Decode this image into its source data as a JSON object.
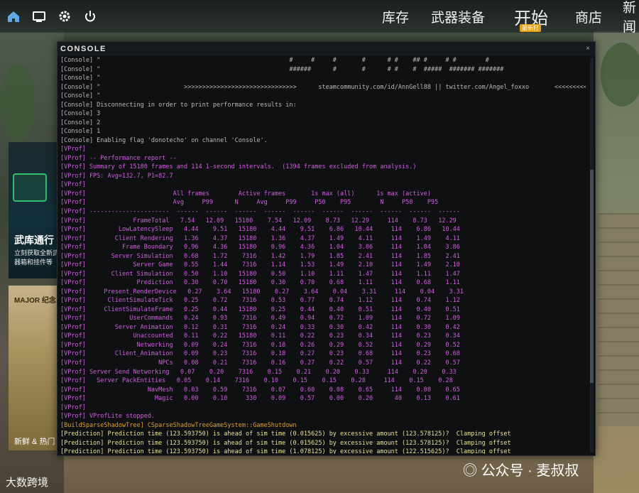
{
  "topbar": {
    "icons": [
      "home-icon",
      "tv-icon",
      "gear-icon",
      "power-icon"
    ],
    "nav": [
      "库存",
      "武器装备",
      "开始",
      "商店",
      "新闻"
    ],
    "badge": "最新打"
  },
  "promo": {
    "title": "武库通行",
    "subtitle": "立刻获取全新武器箱和挂件等",
    "major": "MAJOR 纪念",
    "new_label": "新鲜 & 热门"
  },
  "console": {
    "title": "CONSOLE",
    "close": "×",
    "lines": [
      {
        "text": "[Console] \"                                                    #     #     #       #      # #    ## #     # #        #",
        "kind": "console"
      },
      {
        "text": "[Console] \"                                                    ######      #       #      # #    #  #####  ####### #######",
        "kind": "console"
      },
      {
        "text": "[Console] \"",
        "kind": "console"
      },
      {
        "text": "[Console] \"                       >>>>>>>>>>>>>>>>>>>>>>>>>>>>>>>      steamcommunity.com/id/AnnGell88 || twitter.com/Angel_foxxo       <<<<<<<<<<<<<<<<<<<<<<<<<<<<",
        "kind": "console"
      },
      {
        "text": "[Console] \"",
        "kind": "console"
      },
      {
        "text": "[Console] Disconnecting in order to print performance results in:",
        "kind": "console"
      },
      {
        "text": "[Console] 3",
        "kind": "console"
      },
      {
        "text": "[Console] 2",
        "kind": "console"
      },
      {
        "text": "[Console] 1",
        "kind": "console"
      },
      {
        "text": "[Console] Enabling flag 'donotecho' on channel 'Console'.",
        "kind": "console"
      },
      {
        "text": "[VProf]",
        "kind": "vprof"
      },
      {
        "text": "[VProf] -- Performance report --",
        "kind": "vprof"
      },
      {
        "text": "[VProf] Summary of 15180 frames and 114 1-second intervals.  (1394 frames excluded from analysis.)",
        "kind": "vprof"
      },
      {
        "text": "[VProf] FPS: Avg=132.7, P1=82.7",
        "kind": "vprof"
      },
      {
        "text": "[VProf]",
        "kind": "vprof"
      },
      {
        "text": "[VProf]                        All frames        Active frames       1s max (all)      1s max (active)",
        "kind": "vprof"
      },
      {
        "text": "[VProf]                        Avg     P99      N     Avg     P99     P50    P95        N     P50    P95",
        "kind": "vprof"
      },
      {
        "text": "[VProf] ----------------------  ------  ------  ------  ------  ------  ------  ------  ------  ------  ------",
        "kind": "vprof"
      },
      {
        "text": "[VProf]             FrameTotal   7.54   12.09   15180    7.54   12.09    8.73   12.29     114    8.73   12.29",
        "kind": "vprof"
      },
      {
        "text": "[VProf]         LowLatencySleep   4.44    9.51   15180    4.44    9.51    6.86   10.44     114    6.86   10.44",
        "kind": "vprof"
      },
      {
        "text": "[VProf]        Client Rendering   1.36    4.37   15180    1.36    4.37    1.49    4.11     114    1.49    4.11",
        "kind": "vprof"
      },
      {
        "text": "[VProf]          Frame Boundary   0.96    4.36   15180    0.96    4.36    1.04    3.86     114    1.04    3.86",
        "kind": "vprof"
      },
      {
        "text": "[VProf]       Server Simulation   0.68    1.72    7316    1.42    1.79    1.85    2.41     114    1.85    2.41",
        "kind": "vprof"
      },
      {
        "text": "[VProf]             Server Game   0.55    1.44    7316    1.14    1.53    1.49    2.10     114    1.49    2.10",
        "kind": "vprof"
      },
      {
        "text": "[VProf]       Client Simulation   0.50    1.10   15180    0.50    1.10    1.11    1.47     114    1.11    1.47",
        "kind": "vprof"
      },
      {
        "text": "[VProf]              Prediction   0.30    0.70   15180    0.30    0.70    0.68    1.11     114    0.68    1.11",
        "kind": "vprof"
      },
      {
        "text": "[VProf]     Present_RenderDevice   0.27    3.64   15180    0.27    3.64    0.04    3.31     114    0.04    3.31",
        "kind": "vprof"
      },
      {
        "text": "[VProf]      ClientSimulateTick   0.25    0.72    7316    0.53    0.77    0.74    1.12     114    0.74    1.12",
        "kind": "vprof"
      },
      {
        "text": "[VProf]     ClientSimulateFrame   0.25    0.44   15180    0.25    0.44    0.40    0.51     114    0.40    0.51",
        "kind": "vprof"
      },
      {
        "text": "[VProf]            UserCommands   0.24    0.93    7316    0.49    0.94    0.72    1.09     114    0.72    1.09",
        "kind": "vprof"
      },
      {
        "text": "[VProf]        Server Animation   0.12    0.31    7316    0.24    0.33    0.30    0.42     114    0.30    0.42",
        "kind": "vprof"
      },
      {
        "text": "[VProf]             Unaccounted   0.11    0.22   15180    0.11    0.22    0.23    0.34     114    0.23    0.34",
        "kind": "vprof"
      },
      {
        "text": "[VProf]              Networking   0.09    0.24    7316    0.18    0.26    0.29    0.52     114    0.29    0.52",
        "kind": "vprof"
      },
      {
        "text": "[VProf]        Client_Animation   0.09    0.23    7316    0.18    0.27    0.23    0.68     114    0.23    0.68",
        "kind": "vprof"
      },
      {
        "text": "[VProf]                    NPCs   0.08    0.21    7316    0.16    0.27    0.22    0.57     114    0.22    0.57",
        "kind": "vprof"
      },
      {
        "text": "[VProf] Server Send Networking   0.07    0.20    7316    0.15    0.21    0.20    0.33     114    0.20    0.33",
        "kind": "vprof"
      },
      {
        "text": "[VProf]   Server PackEntities   0.05    0.14    7316    0.10    0.15    0.15    0.28     114    0.15    0.28",
        "kind": "vprof"
      },
      {
        "text": "[VProf]                 NavMesh   0.03    0.59    7316    0.07    0.60    0.08    0.65     114    0.08    0.65",
        "kind": "vprof"
      },
      {
        "text": "[VProf]                   Magic   0.00    0.10     330    0.09    0.57    0.00    0.20      40    0.13    0.61",
        "kind": "vprof"
      },
      {
        "text": "[VProf]",
        "kind": "vprof"
      },
      {
        "text": "[VProf] VProfLite stopped.",
        "kind": "vprof"
      },
      {
        "text": "[BuildSparseShadowTree] CSparseShadowTreeGameSystem::GameShutdown",
        "kind": "build"
      },
      {
        "text": "[Prediction] Prediction time (123.593750) is ahead of sim time (0.015625) by excessive amount (123.578125)?  Clamping offset",
        "kind": "pred"
      },
      {
        "text": "[Prediction] Prediction time (123.593750) is ahead of sim time (0.015625) by excessive amount (123.578125)?  Clamping offset",
        "kind": "pred"
      },
      {
        "text": "[Prediction] Prediction time (123.593750) is ahead of sim time (1.078125) by excessive amount (122.515625)?  Clamping offset",
        "kind": "pred"
      }
    ]
  },
  "watermark": {
    "left": "大数跨境",
    "right": "公众号 · 麦叔叔"
  }
}
